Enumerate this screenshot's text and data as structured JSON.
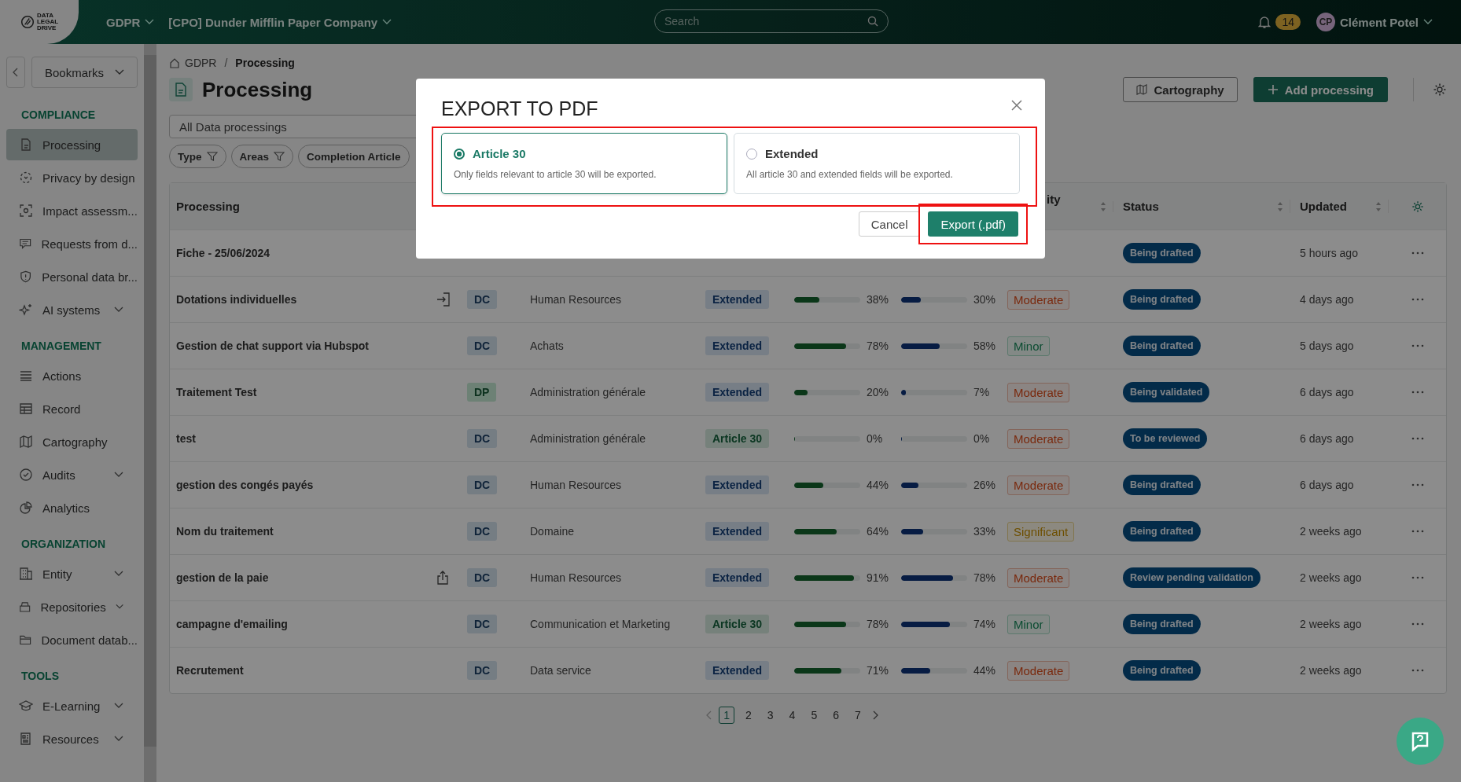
{
  "topbar": {
    "logo": [
      "DATA",
      "LEGAL",
      "DRIVE"
    ],
    "module": "GDPR",
    "company": "[CPO] Dunder Mifflin Paper Company",
    "search": {
      "placeholder": "Search"
    },
    "notifications": "14",
    "avatar": "CP",
    "user": "Clément Potel"
  },
  "sidebar": {
    "bookmarks": "Bookmarks",
    "sections": [
      {
        "title": "COMPLIANCE",
        "items": [
          {
            "label": "Processing",
            "selected": true,
            "expandable": false
          },
          {
            "label": "Privacy by design",
            "selected": false,
            "expandable": false
          },
          {
            "label": "Impact assessm...",
            "selected": false,
            "expandable": false
          },
          {
            "label": "Requests from d...",
            "selected": false,
            "expandable": false
          },
          {
            "label": "Personal data br...",
            "selected": false,
            "expandable": false
          },
          {
            "label": "AI systems",
            "selected": false,
            "expandable": true
          }
        ]
      },
      {
        "title": "MANAGEMENT",
        "items": [
          {
            "label": "Actions",
            "selected": false,
            "expandable": false
          },
          {
            "label": "Record",
            "selected": false,
            "expandable": false
          },
          {
            "label": "Cartography",
            "selected": false,
            "expandable": false
          },
          {
            "label": "Audits",
            "selected": false,
            "expandable": true
          },
          {
            "label": "Analytics",
            "selected": false,
            "expandable": false
          }
        ]
      },
      {
        "title": "ORGANIZATION",
        "items": [
          {
            "label": "Entity",
            "selected": false,
            "expandable": true
          },
          {
            "label": "Repositories",
            "selected": false,
            "expandable": true
          },
          {
            "label": "Document datab...",
            "selected": false,
            "expandable": false
          }
        ]
      },
      {
        "title": "TOOLS",
        "items": [
          {
            "label": "E-Learning",
            "selected": false,
            "expandable": true
          },
          {
            "label": "Resources",
            "selected": false,
            "expandable": true
          }
        ]
      }
    ]
  },
  "breadcrumb": {
    "items": [
      "GDPR",
      "Processing"
    ],
    "separator": "/"
  },
  "page_title": "Processing",
  "actions": [
    "Cartography",
    "Add processing"
  ],
  "view_select": "All Data processings",
  "filters": [
    "Type",
    "Areas",
    "Completion Article"
  ],
  "table": {
    "columns": [
      "Processing",
      "ity",
      "Status",
      "Updated"
    ],
    "rows": [
      {
        "name": "Fiche - 25/06/2024",
        "status": "Being drafted",
        "updated": "5 hours ago"
      },
      {
        "name": "Dotations individuelles",
        "type": {
          "label": "DC",
          "kind": "dc"
        },
        "area": "Human Resources",
        "scope": {
          "label": "Extended",
          "kind": "extended"
        },
        "c1": {
          "level": 0.38,
          "reading": "38%"
        },
        "c2": {
          "level": 0.3,
          "reading": "30%"
        },
        "severity": {
          "label": "Moderate",
          "kind": "moderate"
        },
        "status": "Being drafted",
        "updated": "4 days ago"
      },
      {
        "name": "Gestion de chat support via Hubspot",
        "type": {
          "label": "DC",
          "kind": "dc"
        },
        "area": "Achats",
        "scope": {
          "label": "Extended",
          "kind": "extended"
        },
        "c1": {
          "level": 0.78,
          "reading": "78%"
        },
        "c2": {
          "level": 0.58,
          "reading": "58%"
        },
        "severity": {
          "label": "Minor",
          "kind": "minor"
        },
        "status": "Being drafted",
        "updated": "5 days ago"
      },
      {
        "name": "Traitement Test",
        "type": {
          "label": "DP",
          "kind": "dp"
        },
        "area": "Administration générale",
        "scope": {
          "label": "Extended",
          "kind": "extended"
        },
        "c1": {
          "level": 0.2,
          "reading": "20%"
        },
        "c2": {
          "level": 0.07,
          "reading": "7%"
        },
        "severity": {
          "label": "Moderate",
          "kind": "moderate"
        },
        "status": "Being validated",
        "updated": "6 days ago"
      },
      {
        "name": "test",
        "type": {
          "label": "DC",
          "kind": "dc"
        },
        "area": "Administration générale",
        "scope": {
          "label": "Article 30",
          "kind": "article"
        },
        "c1": {
          "level": 0,
          "reading": "0%"
        },
        "c2": {
          "level": 0,
          "reading": "0%"
        },
        "severity": {
          "label": "Moderate",
          "kind": "moderate"
        },
        "status": "To be reviewed",
        "updated": "6 days ago"
      },
      {
        "name": "gestion des congés payés",
        "type": {
          "label": "DC",
          "kind": "dc"
        },
        "area": "Human Resources",
        "scope": {
          "label": "Extended",
          "kind": "extended"
        },
        "c1": {
          "level": 0.44,
          "reading": "44%"
        },
        "c2": {
          "level": 0.26,
          "reading": "26%"
        },
        "severity": {
          "label": "Moderate",
          "kind": "moderate"
        },
        "status": "Being drafted",
        "updated": "6 days ago"
      },
      {
        "name": "Nom du traitement",
        "type": {
          "label": "DC",
          "kind": "dc"
        },
        "area": "Domaine",
        "scope": {
          "label": "Extended",
          "kind": "extended"
        },
        "c1": {
          "level": 0.64,
          "reading": "64%"
        },
        "c2": {
          "level": 0.33,
          "reading": "33%"
        },
        "severity": {
          "label": "Significant",
          "kind": "significant"
        },
        "status": "Being drafted",
        "updated": "2 weeks ago"
      },
      {
        "name": "gestion de la paie",
        "type": {
          "label": "DC",
          "kind": "dc"
        },
        "area": "Human Resources",
        "scope": {
          "label": "Extended",
          "kind": "extended"
        },
        "c1": {
          "level": 0.91,
          "reading": "91%"
        },
        "c2": {
          "level": 0.78,
          "reading": "78%"
        },
        "severity": {
          "label": "Moderate",
          "kind": "moderate"
        },
        "status": "Review pending validation",
        "updated": "2 weeks ago"
      },
      {
        "name": "campagne d'emailing",
        "type": {
          "label": "DC",
          "kind": "dc"
        },
        "area": "Communication et Marketing",
        "scope": {
          "label": "Article 30",
          "kind": "article"
        },
        "c1": {
          "level": 0.78,
          "reading": "78%"
        },
        "c2": {
          "level": 0.74,
          "reading": "74%"
        },
        "severity": {
          "label": "Minor",
          "kind": "minor"
        },
        "status": "Being drafted",
        "updated": "2 weeks ago"
      },
      {
        "name": "Recrutement",
        "type": {
          "label": "DC",
          "kind": "dc"
        },
        "area": "Data service",
        "scope": {
          "label": "Extended",
          "kind": "extended"
        },
        "c1": {
          "level": 0.71,
          "reading": "71%"
        },
        "c2": {
          "level": 0.44,
          "reading": "44%"
        },
        "severity": {
          "label": "Moderate",
          "kind": "moderate"
        },
        "status": "Being drafted",
        "updated": "2 weeks ago"
      }
    ]
  },
  "pagination": [
    {
      "label": "1",
      "selected": true
    },
    {
      "label": "2",
      "selected": false
    },
    {
      "label": "3",
      "selected": false
    },
    {
      "label": "4",
      "selected": false
    },
    {
      "label": "5",
      "selected": false
    },
    {
      "label": "6",
      "selected": false
    },
    {
      "label": "7",
      "selected": false
    }
  ],
  "modal": {
    "title": "EXPORT TO PDF",
    "options": [
      {
        "label": "Article 30",
        "description": "Only fields relevant to article 30 will be exported.",
        "selected": true
      },
      {
        "label": "Extended",
        "description": "All article 30 and extended fields will be exported.",
        "selected": false
      }
    ],
    "buttons": [
      "Cancel",
      "Export (.pdf)"
    ]
  }
}
